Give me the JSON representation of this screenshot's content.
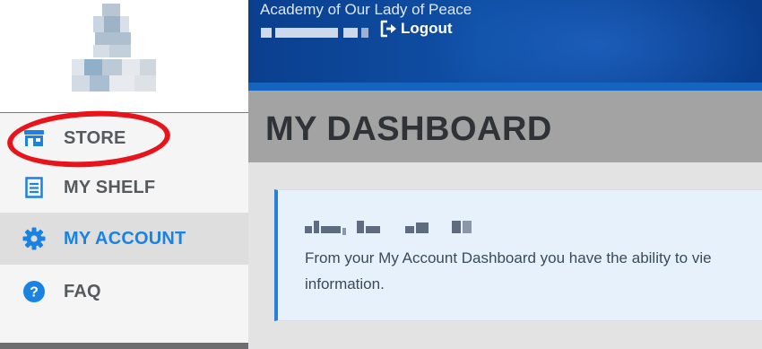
{
  "sidebar": {
    "nav": [
      {
        "label": "STORE",
        "icon": "store-icon"
      },
      {
        "label": "MY SHELF",
        "icon": "shelf-icon"
      },
      {
        "label": "MY ACCOUNT",
        "icon": "gear-icon",
        "active": true
      },
      {
        "label": "FAQ",
        "icon": "help-icon"
      }
    ]
  },
  "header": {
    "school_name": "Academy of Our Lady of Peace",
    "logout_label": "Logout"
  },
  "main": {
    "page_title": "MY DASHBOARD",
    "card_text_line1": "From your My Account Dashboard you have the ability to vie",
    "card_text_line2": "information."
  },
  "colors": {
    "accent": "#1a82e0",
    "header_blue": "#0f4fa5",
    "annotation": "#e8141b"
  }
}
